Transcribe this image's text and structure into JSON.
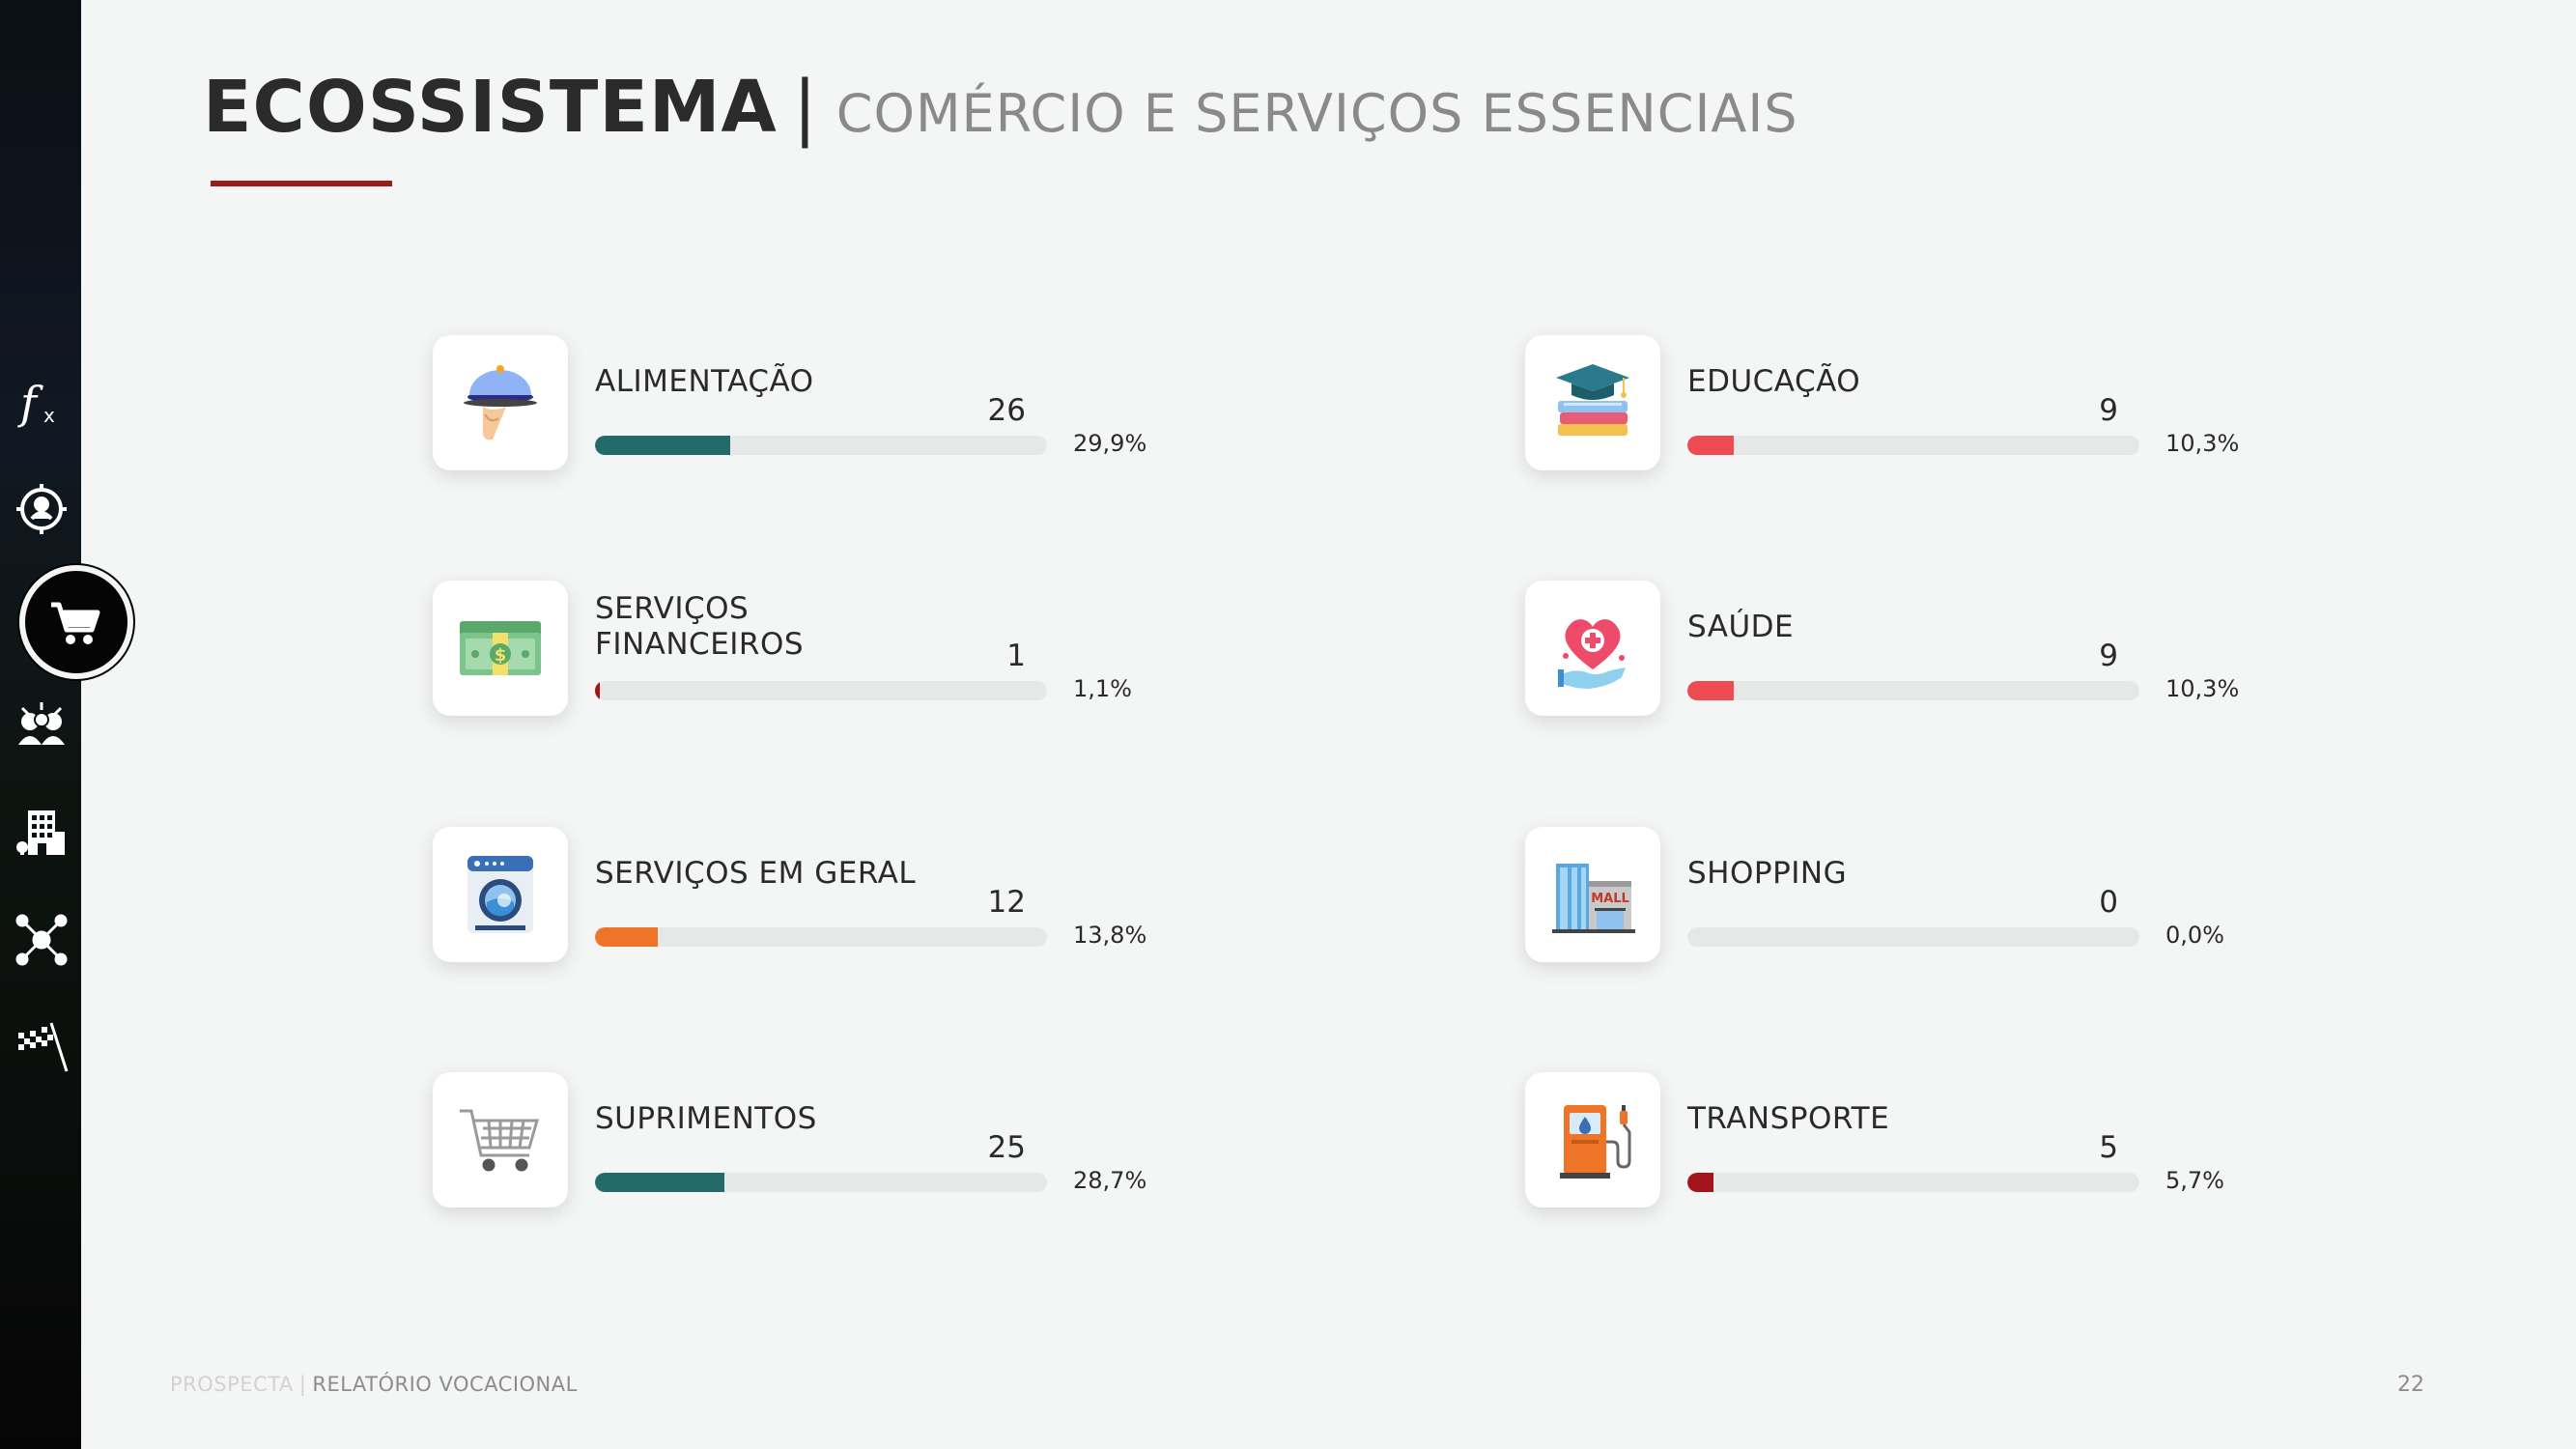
{
  "header": {
    "title": "ECOSSISTEMA",
    "separator": "|",
    "subtitle": "COMÉRCIO E SERVIÇOS ESSENCIAIS"
  },
  "sidebar": {
    "items": [
      {
        "icon": "function-icon"
      },
      {
        "icon": "person-target-icon"
      },
      {
        "icon": "cart-icon",
        "active": true
      },
      {
        "icon": "group-icon"
      },
      {
        "icon": "building-icon"
      },
      {
        "icon": "network-icon"
      },
      {
        "icon": "finish-flag-icon"
      }
    ]
  },
  "items": [
    {
      "label": "ALIMENTAÇÃO",
      "count": "26",
      "pct": "29,9%",
      "share": 0.299,
      "color": "#236b6b",
      "icon": "cloche-icon"
    },
    {
      "label": "SERVIÇOS\nFINANCEIROS",
      "count": "1",
      "pct": "1,1%",
      "share": 0.011,
      "color": "#a3141b",
      "icon": "money-icon"
    },
    {
      "label": "SERVIÇOS EM GERAL",
      "count": "12",
      "pct": "13,8%",
      "share": 0.138,
      "color": "#ee7427",
      "icon": "washing-machine-icon"
    },
    {
      "label": "SUPRIMENTOS",
      "count": "25",
      "pct": "28,7%",
      "share": 0.287,
      "color": "#236b6b",
      "icon": "shopping-cart-icon"
    },
    {
      "label": "EDUCAÇÃO",
      "count": "9",
      "pct": "10,3%",
      "share": 0.103,
      "color": "#ee4b52",
      "icon": "graduation-icon"
    },
    {
      "label": "SAÚDE",
      "count": "9",
      "pct": "10,3%",
      "share": 0.103,
      "color": "#ee4b52",
      "icon": "health-heart-icon"
    },
    {
      "label": "SHOPPING",
      "count": "0",
      "pct": "0,0%",
      "share": 0.0,
      "color": "#ee4b52",
      "icon": "mall-icon"
    },
    {
      "label": "TRANSPORTE",
      "count": "5",
      "pct": "5,7%",
      "share": 0.057,
      "color": "#a3141b",
      "icon": "fuel-pump-icon"
    }
  ],
  "footer": {
    "brand": "PROSPECTA",
    "separator": "|",
    "report": "RELATÓRIO VOCACIONAL",
    "page": "22"
  }
}
